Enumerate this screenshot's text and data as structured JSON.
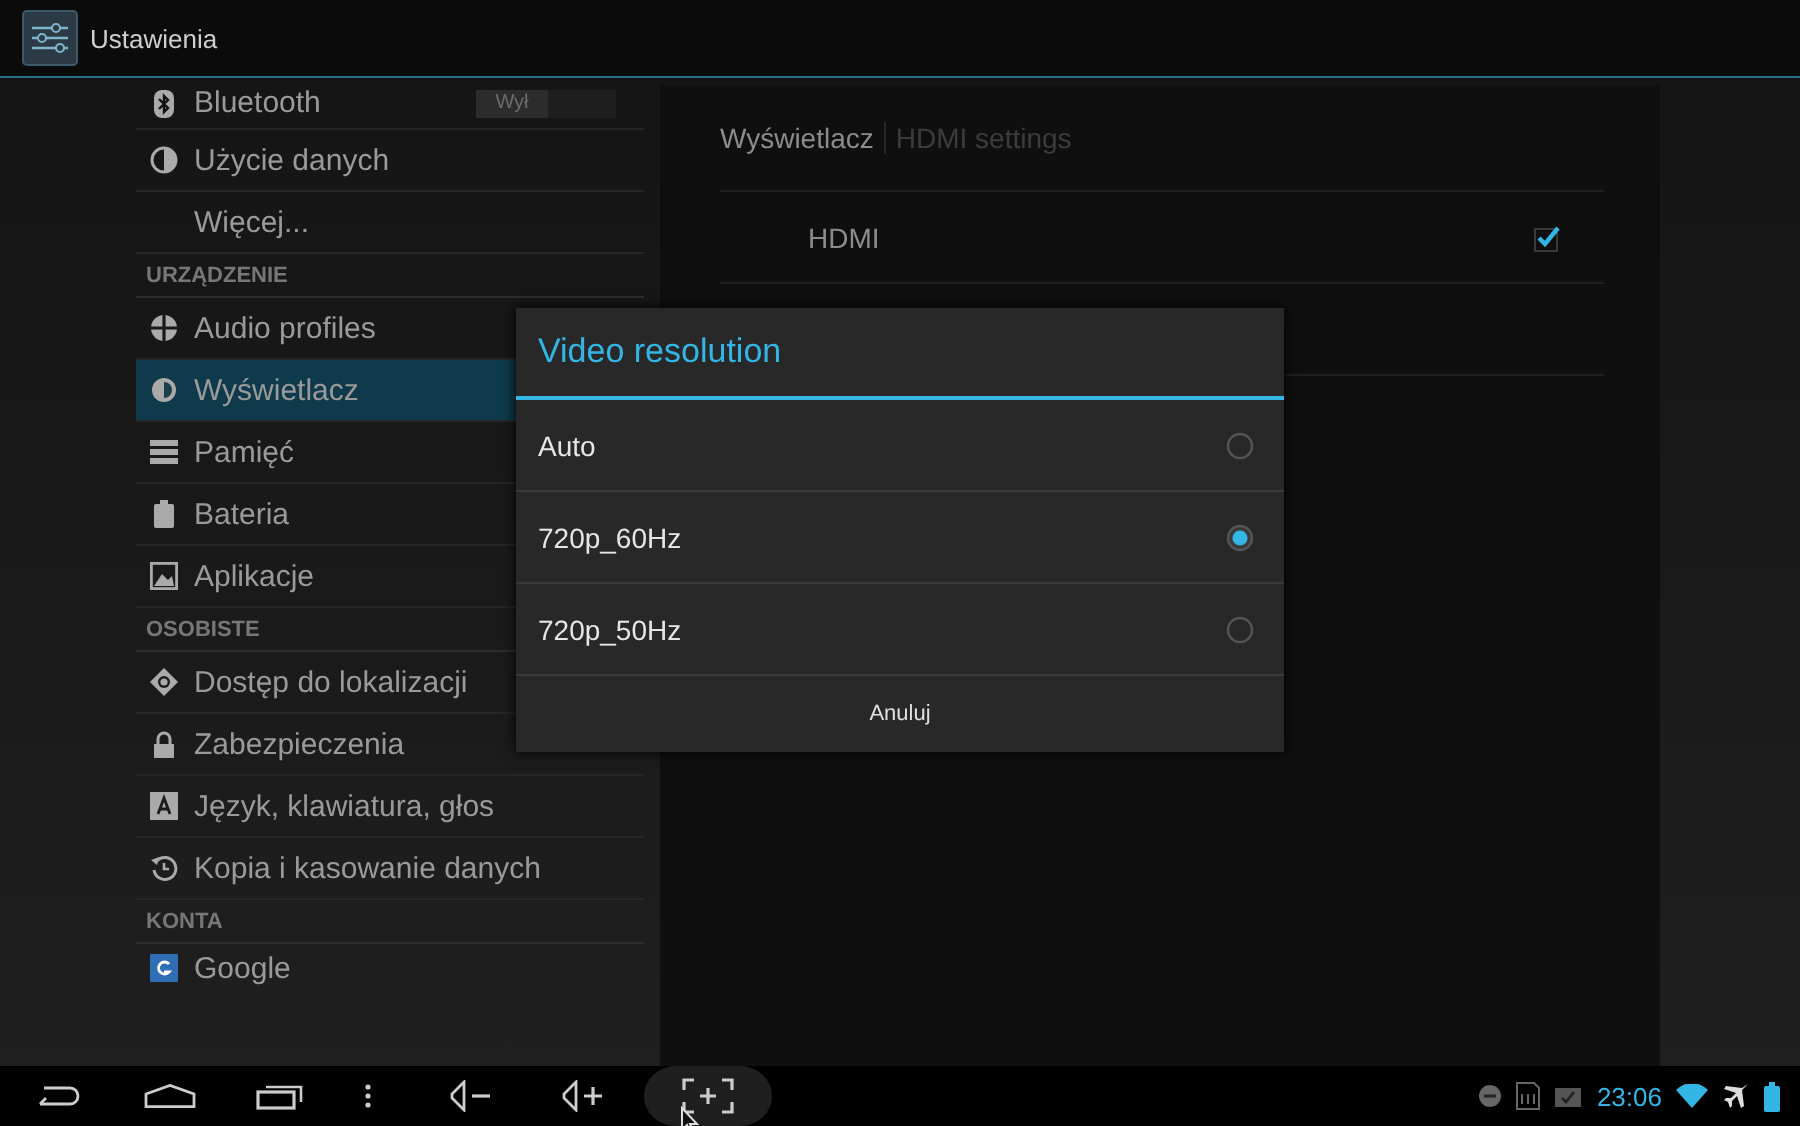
{
  "action_bar": {
    "title": "Ustawienia"
  },
  "sidebar": {
    "sections": [
      {
        "items": [
          {
            "label": "Bluetooth",
            "selected": false,
            "switch": {
              "label": "Wył",
              "on": false
            }
          },
          {
            "label": "Użycie danych",
            "selected": false
          },
          {
            "label": "Więcej...",
            "selected": false
          }
        ]
      },
      {
        "header": "URZĄDZENIE",
        "items": [
          {
            "label": "Audio profiles",
            "selected": false
          },
          {
            "label": "Wyświetlacz",
            "selected": true
          },
          {
            "label": "Pamięć",
            "selected": false
          },
          {
            "label": "Bateria",
            "selected": false
          },
          {
            "label": "Aplikacje",
            "selected": false
          }
        ]
      },
      {
        "header": "OSOBISTE",
        "items": [
          {
            "label": "Dostęp do lokalizacji",
            "selected": false
          },
          {
            "label": "Zabezpieczenia",
            "selected": false
          },
          {
            "label": "Język, klawiatura, głos",
            "selected": false
          },
          {
            "label": "Kopia i kasowanie danych",
            "selected": false
          }
        ]
      },
      {
        "header": "KONTA",
        "items": [
          {
            "label": "Google",
            "selected": false
          }
        ]
      }
    ]
  },
  "detail": {
    "breadcrumb": {
      "current": "Wyświetlacz",
      "sub": "HDMI settings"
    },
    "rows": [
      {
        "label": "HDMI",
        "checked": true
      }
    ]
  },
  "dialog": {
    "title": "Video resolution",
    "options": [
      {
        "label": "Auto",
        "selected": false
      },
      {
        "label": "720p_60Hz",
        "selected": true
      },
      {
        "label": "720p_50Hz",
        "selected": false
      }
    ],
    "cancel": "Anuluj"
  },
  "nav_bar": {
    "buttons": [
      {
        "highlighted": false
      },
      {
        "highlighted": false
      },
      {
        "highlighted": false
      },
      {
        "highlighted": false
      },
      {
        "highlighted": false
      },
      {
        "highlighted": false
      },
      {
        "highlighted": true
      }
    ]
  },
  "status_bar": {
    "time": "23:06"
  }
}
